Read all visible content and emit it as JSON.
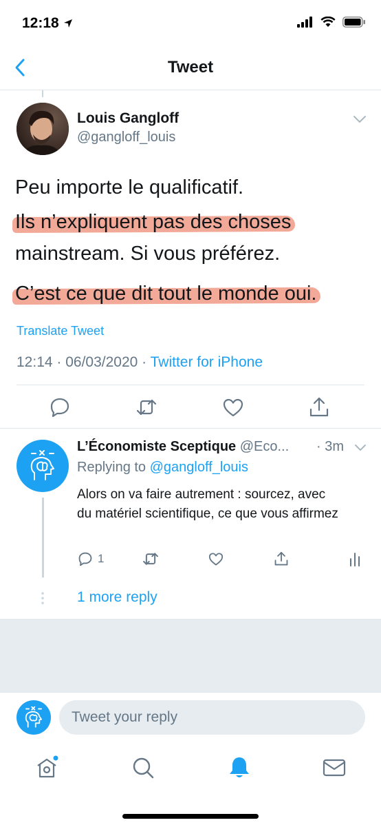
{
  "status_bar": {
    "time": "12:18"
  },
  "nav": {
    "title": "Tweet"
  },
  "tweet": {
    "author_name": "Louis Gangloff",
    "author_handle": "@gangloff_louis",
    "lines": [
      "Peu importe le qualificatif.",
      "Ils n’expliquent pas des choses",
      "mainstream. Si vous préférez.",
      "C’est ce que dit tout le monde oui."
    ],
    "translate_label": "Translate Tweet",
    "timestamp": "12:14 · 06/03/2020 · ",
    "source": "Twitter for iPhone"
  },
  "reply": {
    "author_name": "L’Économiste Sceptique",
    "author_handle": "@Eco...",
    "time": "· 3m",
    "replying_prefix": "Replying to ",
    "replying_to": "@gangloff_louis",
    "text": "Alors on va faire autrement : sourcez, avec du matériel scientifique, ce que vous affirmez",
    "reply_count": "1",
    "more_replies": "1 more reply"
  },
  "compose": {
    "placeholder": "Tweet your reply"
  },
  "colors": {
    "accent": "#1da1f2",
    "highlight": "#f19a86",
    "muted": "#657786"
  },
  "icons": [
    "back-chevron-icon",
    "reply-icon",
    "retweet-icon",
    "like-icon",
    "share-icon",
    "analytics-icon",
    "home-icon",
    "search-icon",
    "notifications-icon",
    "messages-icon"
  ]
}
